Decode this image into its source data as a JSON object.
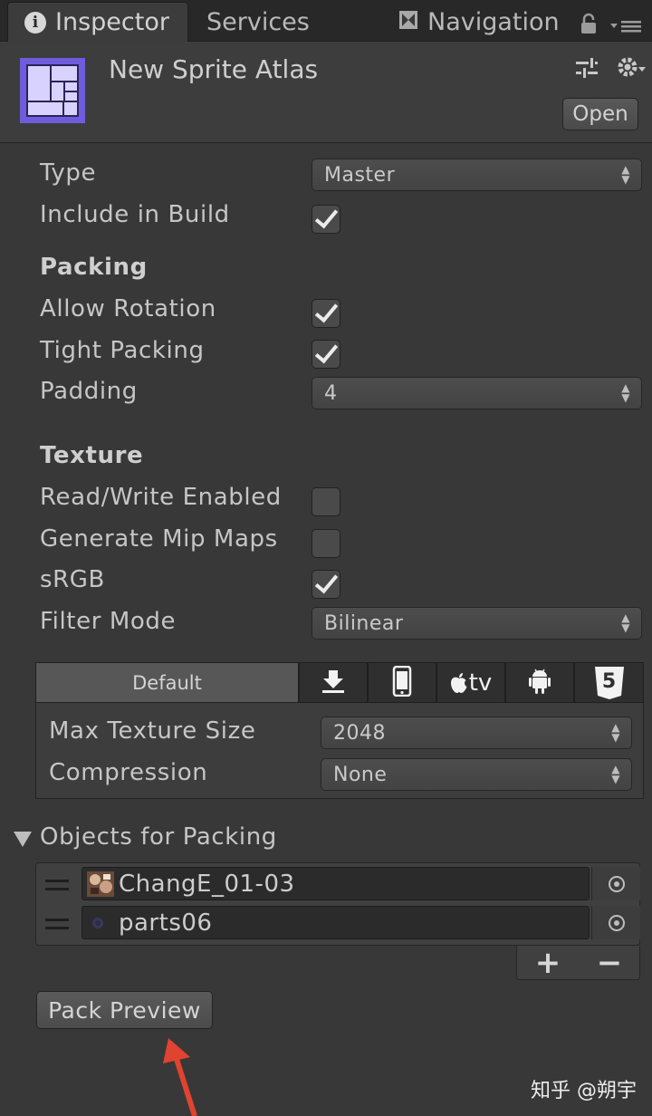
{
  "tabs": [
    {
      "label": "Inspector",
      "icon": "info-icon",
      "active": true
    },
    {
      "label": "Services",
      "active": false
    },
    {
      "label": "Navigation",
      "icon": "navigation-icon",
      "active": false
    }
  ],
  "header": {
    "title": "New Sprite Atlas",
    "open_label": "Open",
    "icon_color": "#6e5bdc"
  },
  "properties": {
    "type": {
      "label": "Type",
      "value": "Master"
    },
    "include_in_build": {
      "label": "Include in Build",
      "checked": true
    }
  },
  "packing": {
    "title": "Packing",
    "allow_rotation": {
      "label": "Allow Rotation",
      "checked": true
    },
    "tight_packing": {
      "label": "Tight Packing",
      "checked": true
    },
    "padding": {
      "label": "Padding",
      "value": "4"
    }
  },
  "texture": {
    "title": "Texture",
    "read_write": {
      "label": "Read/Write Enabled",
      "checked": false
    },
    "mip_maps": {
      "label": "Generate Mip Maps",
      "checked": false
    },
    "srgb": {
      "label": "sRGB",
      "checked": true
    },
    "filter_mode": {
      "label": "Filter Mode",
      "value": "Bilinear"
    }
  },
  "platforms": {
    "tabs": [
      {
        "label": "Default",
        "icon": "default-tab"
      },
      {
        "label": "",
        "icon": "download-icon"
      },
      {
        "label": "",
        "icon": "ios-device-icon"
      },
      {
        "label": "tv",
        "icon": "apple-tv-icon"
      },
      {
        "label": "",
        "icon": "android-icon"
      },
      {
        "label": "5",
        "icon": "html5-icon"
      }
    ],
    "max_texture_size": {
      "label": "Max Texture Size",
      "value": "2048"
    },
    "compression": {
      "label": "Compression",
      "value": "None"
    }
  },
  "objects": {
    "title": "Objects for Packing",
    "items": [
      {
        "name": "ChangE_01-03",
        "thumb": "sprite-thumbnail"
      },
      {
        "name": "parts06",
        "thumb": "sprite-thumbnail"
      }
    ],
    "add_label": "+",
    "remove_label": "−"
  },
  "pack_preview_label": "Pack Preview",
  "annotation": {
    "color": "#e0432f"
  },
  "watermark": "知乎 @朔宇"
}
